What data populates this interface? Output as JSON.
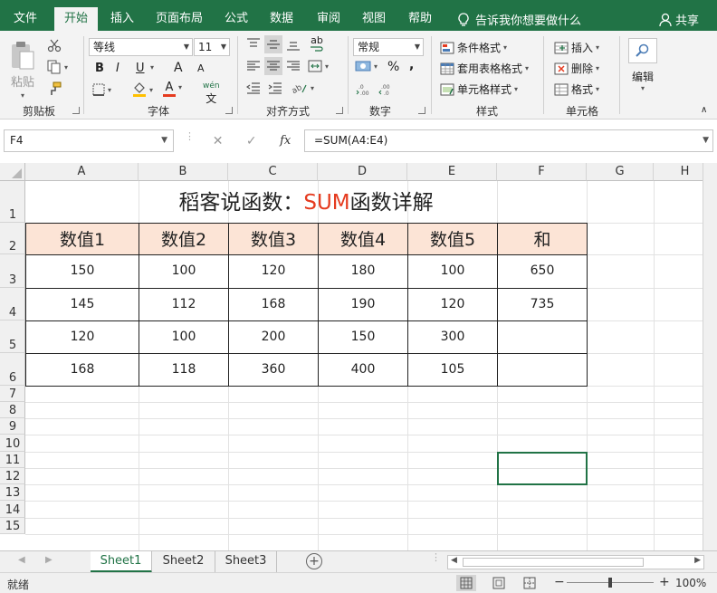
{
  "ribbon_tabs": [
    "文件",
    "开始",
    "插入",
    "页面布局",
    "公式",
    "数据",
    "审阅",
    "视图",
    "帮助"
  ],
  "tell_me": "告诉我你想要做什么",
  "share": "共享",
  "clipboard": {
    "paste": "粘贴",
    "label": "剪贴板"
  },
  "font": {
    "name": "等线",
    "size": "11",
    "bold": "B",
    "italic": "I",
    "underline": "U",
    "grow": "A",
    "shrink": "A",
    "color_letter": "A",
    "wen": "wén",
    "label": "字体",
    "fill_color": "#ffc000",
    "font_color": "#e53b1f"
  },
  "alignment": {
    "label": "对齐方式",
    "wrap": "ab"
  },
  "number": {
    "format": "常规",
    "percent": "%",
    "comma": ",",
    "label": "数字"
  },
  "styles": {
    "cond": "条件格式",
    "table": "套用表格格式",
    "cell": "单元格样式",
    "label": "样式"
  },
  "cells": {
    "insert": "插入",
    "delete": "删除",
    "format": "格式",
    "label": "单元格"
  },
  "editing": {
    "label": "编辑"
  },
  "formula_bar": {
    "name_box": "F4",
    "fx": "fx",
    "formula": "=SUM(A4:E4)"
  },
  "columns": [
    "A",
    "B",
    "C",
    "D",
    "E",
    "F",
    "G",
    "H"
  ],
  "rows": [
    "1",
    "2",
    "3",
    "4",
    "5",
    "6",
    "7",
    "8",
    "9",
    "10",
    "11",
    "12",
    "13",
    "14",
    "15"
  ],
  "sheet": {
    "title_prefix": "稻客说函数：",
    "title_highlight": "SUM",
    "title_suffix": "函数详解",
    "headers": [
      "数值1",
      "数值2",
      "数值3",
      "数值4",
      "数值5",
      "和"
    ],
    "data": [
      [
        "150",
        "100",
        "120",
        "180",
        "100",
        "650"
      ],
      [
        "145",
        "112",
        "168",
        "190",
        "120",
        "735"
      ],
      [
        "120",
        "100",
        "200",
        "150",
        "300",
        ""
      ],
      [
        "168",
        "118",
        "360",
        "400",
        "105",
        ""
      ]
    ]
  },
  "sheet_tabs": [
    "Sheet1",
    "Sheet2",
    "Sheet3"
  ],
  "status": {
    "ready": "就绪",
    "zoom": "100%",
    "minus": "−",
    "plus": "+"
  },
  "colors": {
    "brand": "#217346",
    "header_fill": "#fce4d6",
    "title_accent": "#e53b1f"
  }
}
